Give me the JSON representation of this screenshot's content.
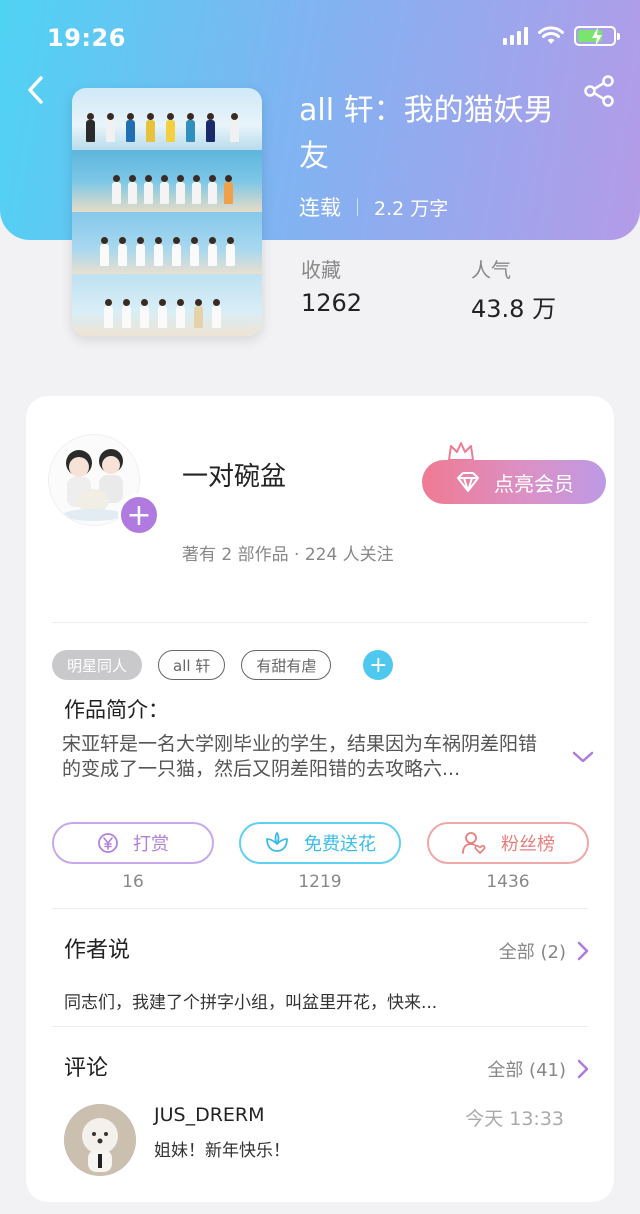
{
  "status_bar": {
    "time": "19:26"
  },
  "book": {
    "title": "all 轩：我的猫妖男友",
    "status": "连载",
    "word_count": "2.2 万字",
    "stats": [
      {
        "label": "收藏",
        "value": "1262"
      },
      {
        "label": "人气",
        "value": "43.8 万"
      }
    ]
  },
  "author": {
    "name": "一对碗盆",
    "info": "著有 2 部作品 · 224 人关注",
    "vip_button": "点亮会员"
  },
  "tags": [
    "明星同人",
    "all 轩",
    "有甜有虐"
  ],
  "intro": {
    "title": "作品简介：",
    "text": "宋亚轩是一名大学刚毕业的学生，结果因为车祸阴差阳错的变成了一只猫，然后又阴差阳错的去攻略六..."
  },
  "actions": [
    {
      "label": "打赏",
      "count": "16",
      "icon": "yen-coin-icon",
      "color": "#b082de"
    },
    {
      "label": "免费送花",
      "count": "1219",
      "icon": "flower-icon",
      "color": "#3bbde8"
    },
    {
      "label": "粉丝榜",
      "count": "1436",
      "icon": "fan-user-heart-icon",
      "color": "#e77f7f"
    }
  ],
  "author_says": {
    "title": "作者说",
    "all_label": "全部 (2)",
    "text": "同志们，我建了个拼字小组，叫盆里开花，快来..."
  },
  "comments": {
    "title": "评论",
    "all_label": "全部 (41)",
    "items": [
      {
        "user": "JUS_DRERM",
        "time": "今天 13:33",
        "text": "姐妹！新年快乐！"
      }
    ]
  },
  "colors": {
    "hero_gradient_start": "#4fd3f3",
    "hero_gradient_end": "#b49be8",
    "accent_purple": "#b07ae0",
    "accent_blue": "#4fc8f0",
    "accent_pink": "#f07a93"
  }
}
